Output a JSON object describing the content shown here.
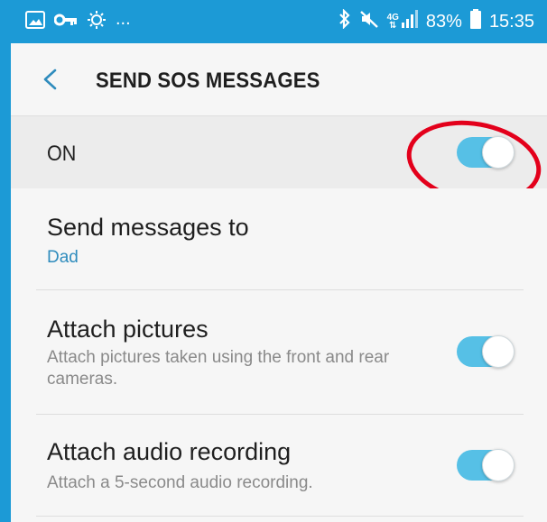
{
  "status_bar": {
    "left_icons": [
      "image-icon",
      "key-icon",
      "sun-icon"
    ],
    "overflow": "...",
    "network": "4G",
    "battery": "83%",
    "time": "15:35"
  },
  "app_bar": {
    "title": "SEND SOS MESSAGES"
  },
  "master_switch": {
    "label": "ON",
    "checked": true
  },
  "settings": [
    {
      "title": "Send messages to",
      "value": "Dad"
    },
    {
      "title": "Attach pictures",
      "subtitle": "Attach pictures taken using the front and rear cameras.",
      "checked": true
    },
    {
      "title": "Attach audio recording",
      "subtitle": "Attach a 5-second audio recording.",
      "checked": true
    }
  ],
  "colors": {
    "status_bar": "#1c9ad6",
    "toggle_on": "#56c0e6",
    "link_value": "#2f8cbd",
    "highlight_circle": "#e3001b"
  }
}
